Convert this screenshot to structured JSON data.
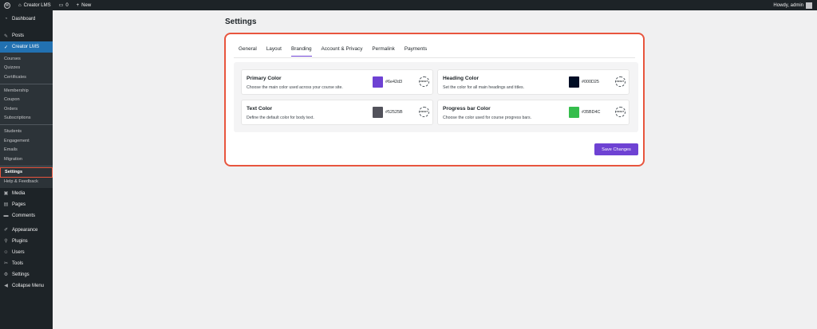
{
  "adminbar": {
    "site_name": "Creator LMS",
    "comments_count": "0",
    "new_label": "New",
    "howdy": "Howdy, admin"
  },
  "sidebar": {
    "top_items": [
      {
        "label": "Dashboard",
        "icon": "dashboard-icon"
      },
      {
        "label": "Posts",
        "icon": "pin-icon"
      },
      {
        "label": "Creator LMS",
        "icon": "creator-lms-icon"
      }
    ],
    "submenu": {
      "group1": [
        "Courses",
        "Quizzes",
        "Certificates"
      ],
      "group2": [
        "Membership",
        "Coupon",
        "Orders",
        "Subscriptions"
      ],
      "group3": [
        "Students",
        "Engagement",
        "Emails",
        "Migration"
      ],
      "group4": [
        "Settings",
        "Help & Feedback"
      ]
    },
    "bottom_items": [
      {
        "label": "Media",
        "icon": "media-icon"
      },
      {
        "label": "Pages",
        "icon": "pages-icon"
      },
      {
        "label": "Comments",
        "icon": "comments-icon"
      },
      {
        "label": "Appearance",
        "icon": "appearance-icon"
      },
      {
        "label": "Plugins",
        "icon": "plugins-icon"
      },
      {
        "label": "Users",
        "icon": "users-icon"
      },
      {
        "label": "Tools",
        "icon": "tools-icon"
      },
      {
        "label": "Settings",
        "icon": "settings-icon"
      },
      {
        "label": "Collapse Menu",
        "icon": "collapse-icon"
      }
    ]
  },
  "page": {
    "title": "Settings",
    "tabs": [
      "General",
      "Layout",
      "Branding",
      "Account & Privacy",
      "Permalink",
      "Payments"
    ],
    "selected_tab": "Branding",
    "colors": [
      {
        "title": "Primary Color",
        "desc": "Choose the main color used across your course site.",
        "hex": "#6e42d3",
        "swatch": "#6e42d3"
      },
      {
        "title": "Heading Color",
        "desc": "Set the color for all main headings and titles.",
        "hex": "#000D25",
        "swatch": "#000D25"
      },
      {
        "title": "Text Color",
        "desc": "Define the default color for body text.",
        "hex": "#52525B",
        "swatch": "#52525B"
      },
      {
        "title": "Progress bar Color",
        "desc": "Choose the color used for course progress bars.",
        "hex": "#35BD4C",
        "swatch": "#35BD4C"
      }
    ],
    "reset_label": "RESET",
    "save_label": "Save Changes"
  },
  "theme": {
    "accent": "#6e42d3",
    "highlight": "#e8553e",
    "sidebar_bg": "#1d2327",
    "active_menu": "#2271b1"
  }
}
